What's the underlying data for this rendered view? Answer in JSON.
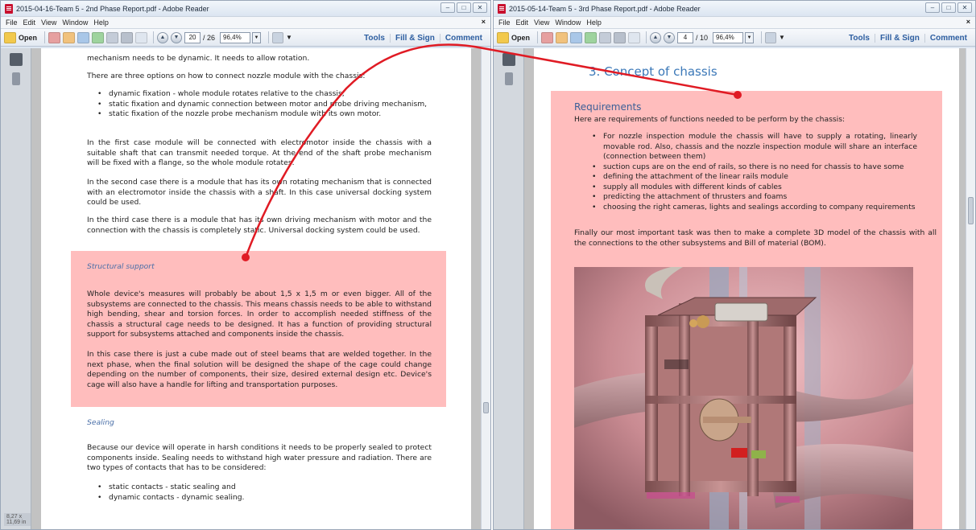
{
  "left": {
    "title": "2015-04-16-Team 5 - 2nd Phase Report.pdf - Adobe Reader",
    "menu": [
      "File",
      "Edit",
      "View",
      "Window",
      "Help"
    ],
    "toolbar": {
      "open_label": "Open",
      "page_current": "20",
      "page_total": "/ 26",
      "zoom": "96,4%",
      "tools": "Tools",
      "fill_sign": "Fill & Sign",
      "comment": "Comment"
    },
    "page_size_label": "8,27 x 11,69 in",
    "page": {
      "intro_line": "mechanism needs to be dynamic. It needs to allow rotation.",
      "options_intro": "There are three options on how to connect nozzle module with the chassis:",
      "options": [
        "dynamic fixation - whole module rotates relative to the chassis,",
        "static fixation and dynamic connection between motor and probe driving mechanism,",
        "static fixation of the nozzle probe mechanism module with its own motor."
      ],
      "case1": "In the first case module will be connected with electromotor inside the chassis with a suitable shaft that can transmit needed torque. At the end of the shaft probe mechanism will be fixed with a flange, so the whole module rotates.",
      "case2": "In the second case there is a module that has its own rotating mechanism that is connected with an electromotor inside the chassis with a shaft. In this case universal docking system could be used.",
      "case3": "In the third case there is a module that has its own driving mechanism with motor and the connection with the chassis is completely static. Universal docking system could be used.",
      "structural_heading": "Structural support",
      "structural_p1": "Whole device's measures will probably be about 1,5 x 1,5 m or even bigger. All of the subsystems are connected to the chassis. This means chassis needs to be able to withstand high bending, shear and torsion forces. In order to accomplish needed stiffness of the chassis a structural cage needs to be designed. It has a function of providing structural support for subsystems attached and components inside the chassis.",
      "structural_p2": "In this case there is just a cube made out of steel beams that are welded together. In the next phase, when the final solution will be designed the shape of the cage could change depending on the number of components, their size, desired external design etc. Device's cage will also have a handle for lifting and transportation purposes.",
      "sealing_heading": "Sealing",
      "sealing_p": "Because our device will operate in harsh conditions it needs to be properly sealed to protect components inside. Sealing needs to withstand high water pressure and radiation. There are two types of contacts that has to be considered:",
      "contacts": [
        "static contacts - static sealing and",
        "dynamic contacts - dynamic sealing."
      ]
    }
  },
  "right": {
    "title": "2015-05-14-Team 5 - 3rd Phase Report.pdf - Adobe Reader",
    "menu": [
      "File",
      "Edit",
      "View",
      "Window",
      "Help"
    ],
    "toolbar": {
      "open_label": "Open",
      "page_current": "4",
      "page_total": "/ 10",
      "zoom": "96,4%",
      "tools": "Tools",
      "fill_sign": "Fill & Sign",
      "comment": "Comment"
    },
    "page": {
      "chapter_title": "3. Concept of chassis",
      "req_heading": "Requirements",
      "req_intro": "Here are requirements of functions needed to be perform by the chassis:",
      "requirements": [
        "For nozzle inspection module the chassis will have to supply a rotating, linearly movable rod. Also, chassis and the nozzle inspection module will share an interface (connection between them)",
        "suction cups are on the end of rails, so there is no need for chassis to have some",
        "defining the attachment of the linear rails module",
        "supply all modules with different kinds of cables",
        "predicting the attachment of thrusters and foams",
        "choosing the right cameras, lights and sealings according to company requirements"
      ],
      "final_p": "Finally our most important task was then to make a complete 3D model of the chassis with all the connections to the other subsystems and Bill of material (BOM)."
    }
  },
  "colors": {
    "highlight": "#ffbdbd",
    "connector": "#e01b24",
    "heading_blue": "#3b78b8"
  }
}
